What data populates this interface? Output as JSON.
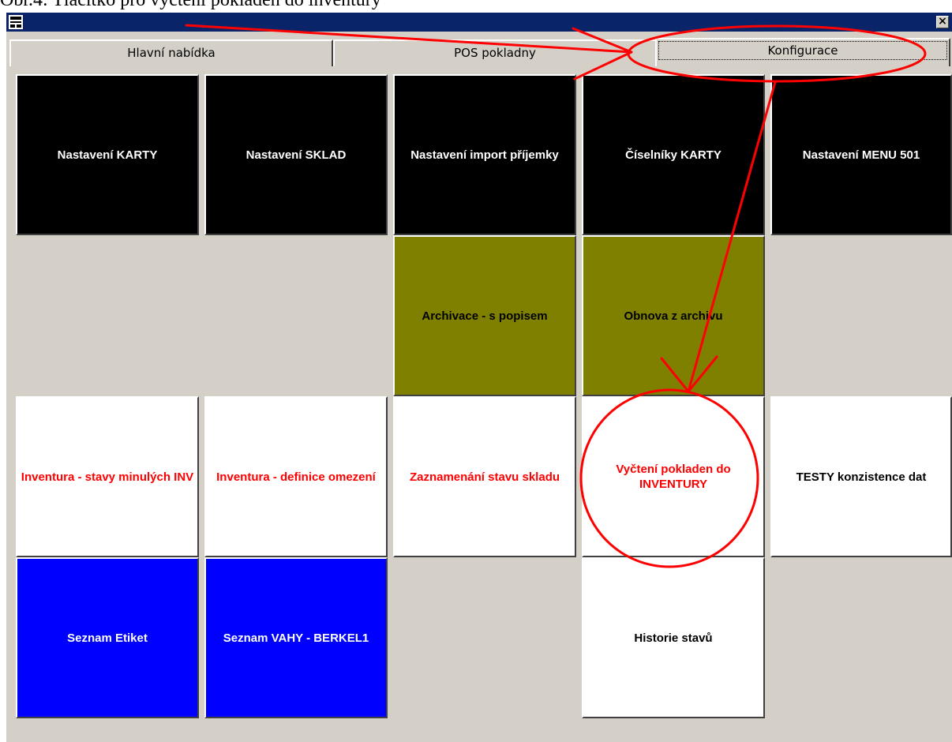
{
  "caption": "Obr.4: Tlačítko pro vyčtení pokladen do inventury",
  "window": {
    "close_glyph": "×"
  },
  "tabs": [
    {
      "label": "Hlavní nabídka",
      "active": false
    },
    {
      "label": "POS pokladny",
      "active": false
    },
    {
      "label": "Konfigurace",
      "active": true
    }
  ],
  "colors": {
    "black_tile": "#000000",
    "olive_tile": "#808000",
    "white_tile": "#ffffff",
    "blue_tile": "#0000ff",
    "red_text": "#ff0000",
    "annotation": "#ff0000",
    "titlebar": "#0a246a",
    "panel": "#d4d0c8"
  },
  "tiles": {
    "nastaveni_karty": "Nastavení KARTY",
    "nastaveni_sklad": "Nastavení SKLAD",
    "nastaveni_import": "Nastavení import příjemky",
    "ciselniky_karty": "Číselníky KARTY",
    "nastaveni_menu": "Nastavení MENU 501",
    "archivace": "Archivace - s popisem",
    "obnova": "Obnova z archivu",
    "inventura_stavy": "Inventura - stavy minulých INV",
    "inventura_definice": "Inventura - definice omezení",
    "zaznamenani": "Zaznamenání stavu skladu",
    "vycteni": "Vyčtení pokladen do INVENTURY",
    "testy": "TESTY konzistence dat",
    "seznam_etiket": "Seznam Etiket",
    "seznam_vahy": "Seznam VAHY - BERKEL1",
    "historie": "Historie stavů"
  }
}
